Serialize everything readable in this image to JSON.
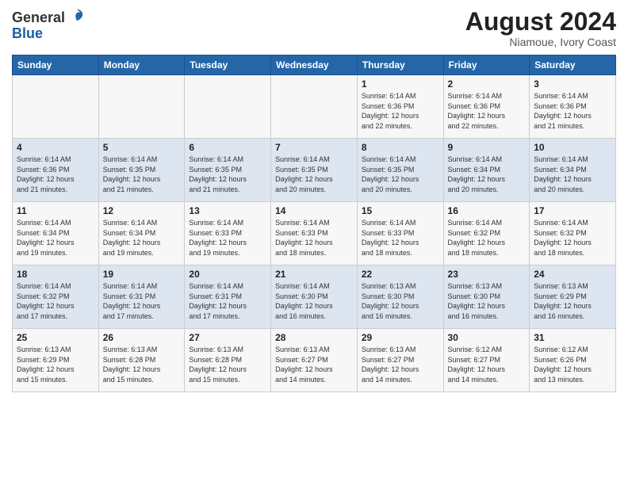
{
  "header": {
    "logo_line1": "General",
    "logo_line2": "Blue",
    "month": "August 2024",
    "location": "Niamoue, Ivory Coast"
  },
  "weekdays": [
    "Sunday",
    "Monday",
    "Tuesday",
    "Wednesday",
    "Thursday",
    "Friday",
    "Saturday"
  ],
  "weeks": [
    [
      {
        "day": "",
        "info": ""
      },
      {
        "day": "",
        "info": ""
      },
      {
        "day": "",
        "info": ""
      },
      {
        "day": "",
        "info": ""
      },
      {
        "day": "1",
        "info": "Sunrise: 6:14 AM\nSunset: 6:36 PM\nDaylight: 12 hours\nand 22 minutes."
      },
      {
        "day": "2",
        "info": "Sunrise: 6:14 AM\nSunset: 6:36 PM\nDaylight: 12 hours\nand 22 minutes."
      },
      {
        "day": "3",
        "info": "Sunrise: 6:14 AM\nSunset: 6:36 PM\nDaylight: 12 hours\nand 21 minutes."
      }
    ],
    [
      {
        "day": "4",
        "info": "Sunrise: 6:14 AM\nSunset: 6:36 PM\nDaylight: 12 hours\nand 21 minutes."
      },
      {
        "day": "5",
        "info": "Sunrise: 6:14 AM\nSunset: 6:35 PM\nDaylight: 12 hours\nand 21 minutes."
      },
      {
        "day": "6",
        "info": "Sunrise: 6:14 AM\nSunset: 6:35 PM\nDaylight: 12 hours\nand 21 minutes."
      },
      {
        "day": "7",
        "info": "Sunrise: 6:14 AM\nSunset: 6:35 PM\nDaylight: 12 hours\nand 20 minutes."
      },
      {
        "day": "8",
        "info": "Sunrise: 6:14 AM\nSunset: 6:35 PM\nDaylight: 12 hours\nand 20 minutes."
      },
      {
        "day": "9",
        "info": "Sunrise: 6:14 AM\nSunset: 6:34 PM\nDaylight: 12 hours\nand 20 minutes."
      },
      {
        "day": "10",
        "info": "Sunrise: 6:14 AM\nSunset: 6:34 PM\nDaylight: 12 hours\nand 20 minutes."
      }
    ],
    [
      {
        "day": "11",
        "info": "Sunrise: 6:14 AM\nSunset: 6:34 PM\nDaylight: 12 hours\nand 19 minutes."
      },
      {
        "day": "12",
        "info": "Sunrise: 6:14 AM\nSunset: 6:34 PM\nDaylight: 12 hours\nand 19 minutes."
      },
      {
        "day": "13",
        "info": "Sunrise: 6:14 AM\nSunset: 6:33 PM\nDaylight: 12 hours\nand 19 minutes."
      },
      {
        "day": "14",
        "info": "Sunrise: 6:14 AM\nSunset: 6:33 PM\nDaylight: 12 hours\nand 18 minutes."
      },
      {
        "day": "15",
        "info": "Sunrise: 6:14 AM\nSunset: 6:33 PM\nDaylight: 12 hours\nand 18 minutes."
      },
      {
        "day": "16",
        "info": "Sunrise: 6:14 AM\nSunset: 6:32 PM\nDaylight: 12 hours\nand 18 minutes."
      },
      {
        "day": "17",
        "info": "Sunrise: 6:14 AM\nSunset: 6:32 PM\nDaylight: 12 hours\nand 18 minutes."
      }
    ],
    [
      {
        "day": "18",
        "info": "Sunrise: 6:14 AM\nSunset: 6:32 PM\nDaylight: 12 hours\nand 17 minutes."
      },
      {
        "day": "19",
        "info": "Sunrise: 6:14 AM\nSunset: 6:31 PM\nDaylight: 12 hours\nand 17 minutes."
      },
      {
        "day": "20",
        "info": "Sunrise: 6:14 AM\nSunset: 6:31 PM\nDaylight: 12 hours\nand 17 minutes."
      },
      {
        "day": "21",
        "info": "Sunrise: 6:14 AM\nSunset: 6:30 PM\nDaylight: 12 hours\nand 16 minutes."
      },
      {
        "day": "22",
        "info": "Sunrise: 6:13 AM\nSunset: 6:30 PM\nDaylight: 12 hours\nand 16 minutes."
      },
      {
        "day": "23",
        "info": "Sunrise: 6:13 AM\nSunset: 6:30 PM\nDaylight: 12 hours\nand 16 minutes."
      },
      {
        "day": "24",
        "info": "Sunrise: 6:13 AM\nSunset: 6:29 PM\nDaylight: 12 hours\nand 16 minutes."
      }
    ],
    [
      {
        "day": "25",
        "info": "Sunrise: 6:13 AM\nSunset: 6:29 PM\nDaylight: 12 hours\nand 15 minutes."
      },
      {
        "day": "26",
        "info": "Sunrise: 6:13 AM\nSunset: 6:28 PM\nDaylight: 12 hours\nand 15 minutes."
      },
      {
        "day": "27",
        "info": "Sunrise: 6:13 AM\nSunset: 6:28 PM\nDaylight: 12 hours\nand 15 minutes."
      },
      {
        "day": "28",
        "info": "Sunrise: 6:13 AM\nSunset: 6:27 PM\nDaylight: 12 hours\nand 14 minutes."
      },
      {
        "day": "29",
        "info": "Sunrise: 6:13 AM\nSunset: 6:27 PM\nDaylight: 12 hours\nand 14 minutes."
      },
      {
        "day": "30",
        "info": "Sunrise: 6:12 AM\nSunset: 6:27 PM\nDaylight: 12 hours\nand 14 minutes."
      },
      {
        "day": "31",
        "info": "Sunrise: 6:12 AM\nSunset: 6:26 PM\nDaylight: 12 hours\nand 13 minutes."
      }
    ]
  ]
}
